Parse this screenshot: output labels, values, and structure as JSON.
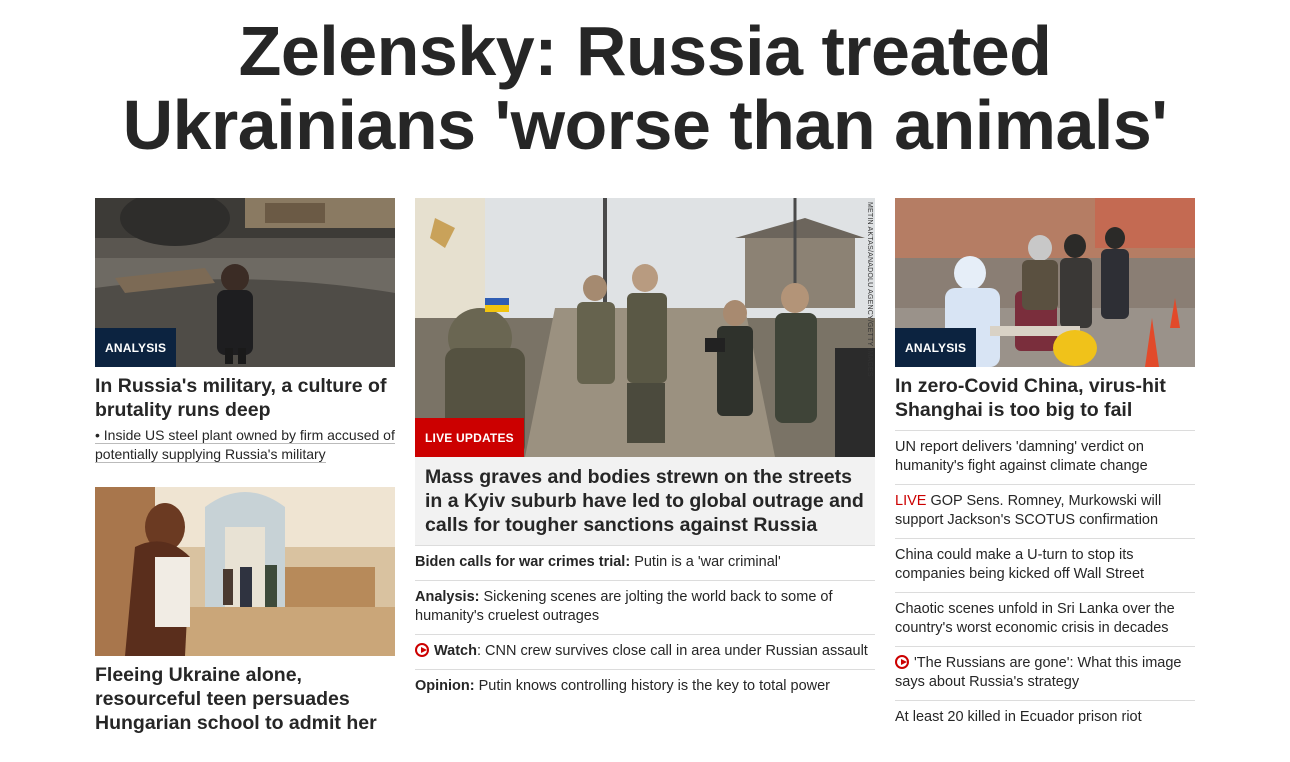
{
  "headline": {
    "line1": "Zelensky: Russia treated",
    "line2": "Ukrainians 'worse than animals'"
  },
  "left": {
    "top_card": {
      "badge": "ANALYSIS",
      "title": "In Russia's military, a culture of brutality runs deep",
      "sub_link": "• Inside US steel plant owned by firm accused of potentially supplying Russia's military"
    },
    "bottom_card": {
      "title": "Fleeing Ukraine alone, resourceful teen persuades Hungarian school to admit her"
    }
  },
  "middle": {
    "badge": "LIVE UPDATES",
    "photo_credit": "METIN AKTAS/ANADOLU AGENCY/GETTY IMAGES",
    "title": "Mass graves and bodies strewn on the streets in a Kyiv suburb have led to global outrage and calls for tougher sanctions against Russia",
    "items": [
      {
        "prefix": "Biden calls for war crimes trial:",
        "text": " Putin is a 'war criminal'",
        "icon": ""
      },
      {
        "prefix": "Analysis:",
        "text": " Sickening scenes are jolting the world back to some of humanity's cruelest outrages",
        "icon": ""
      },
      {
        "prefix": "Watch",
        "text": ": CNN crew survives close call in area under Russian assault",
        "icon": "play-icon"
      },
      {
        "prefix": "Opinion:",
        "text": " Putin knows controlling history is the key to total power",
        "icon": ""
      }
    ]
  },
  "right": {
    "badge": "ANALYSIS",
    "title": "In zero-Covid China, virus-hit Shanghai is too big to fail",
    "items": [
      {
        "live": "",
        "text": "UN report delivers 'damning' verdict on humanity's fight against climate change",
        "icon": ""
      },
      {
        "live": "LIVE",
        "text": " GOP Sens. Romney, Murkowski will support Jackson's SCOTUS confirmation",
        "icon": ""
      },
      {
        "live": "",
        "text": "China could make a U-turn to stop its companies being kicked off Wall Street",
        "icon": ""
      },
      {
        "live": "",
        "text": "Chaotic scenes unfold in Sri Lanka over the country's worst economic crisis in decades",
        "icon": ""
      },
      {
        "live": "",
        "text": "'The Russians are gone': What this image says about Russia's strategy",
        "icon": "play-icon"
      },
      {
        "live": "",
        "text": "At least 20 killed in Ecuador prison riot",
        "icon": ""
      }
    ]
  }
}
